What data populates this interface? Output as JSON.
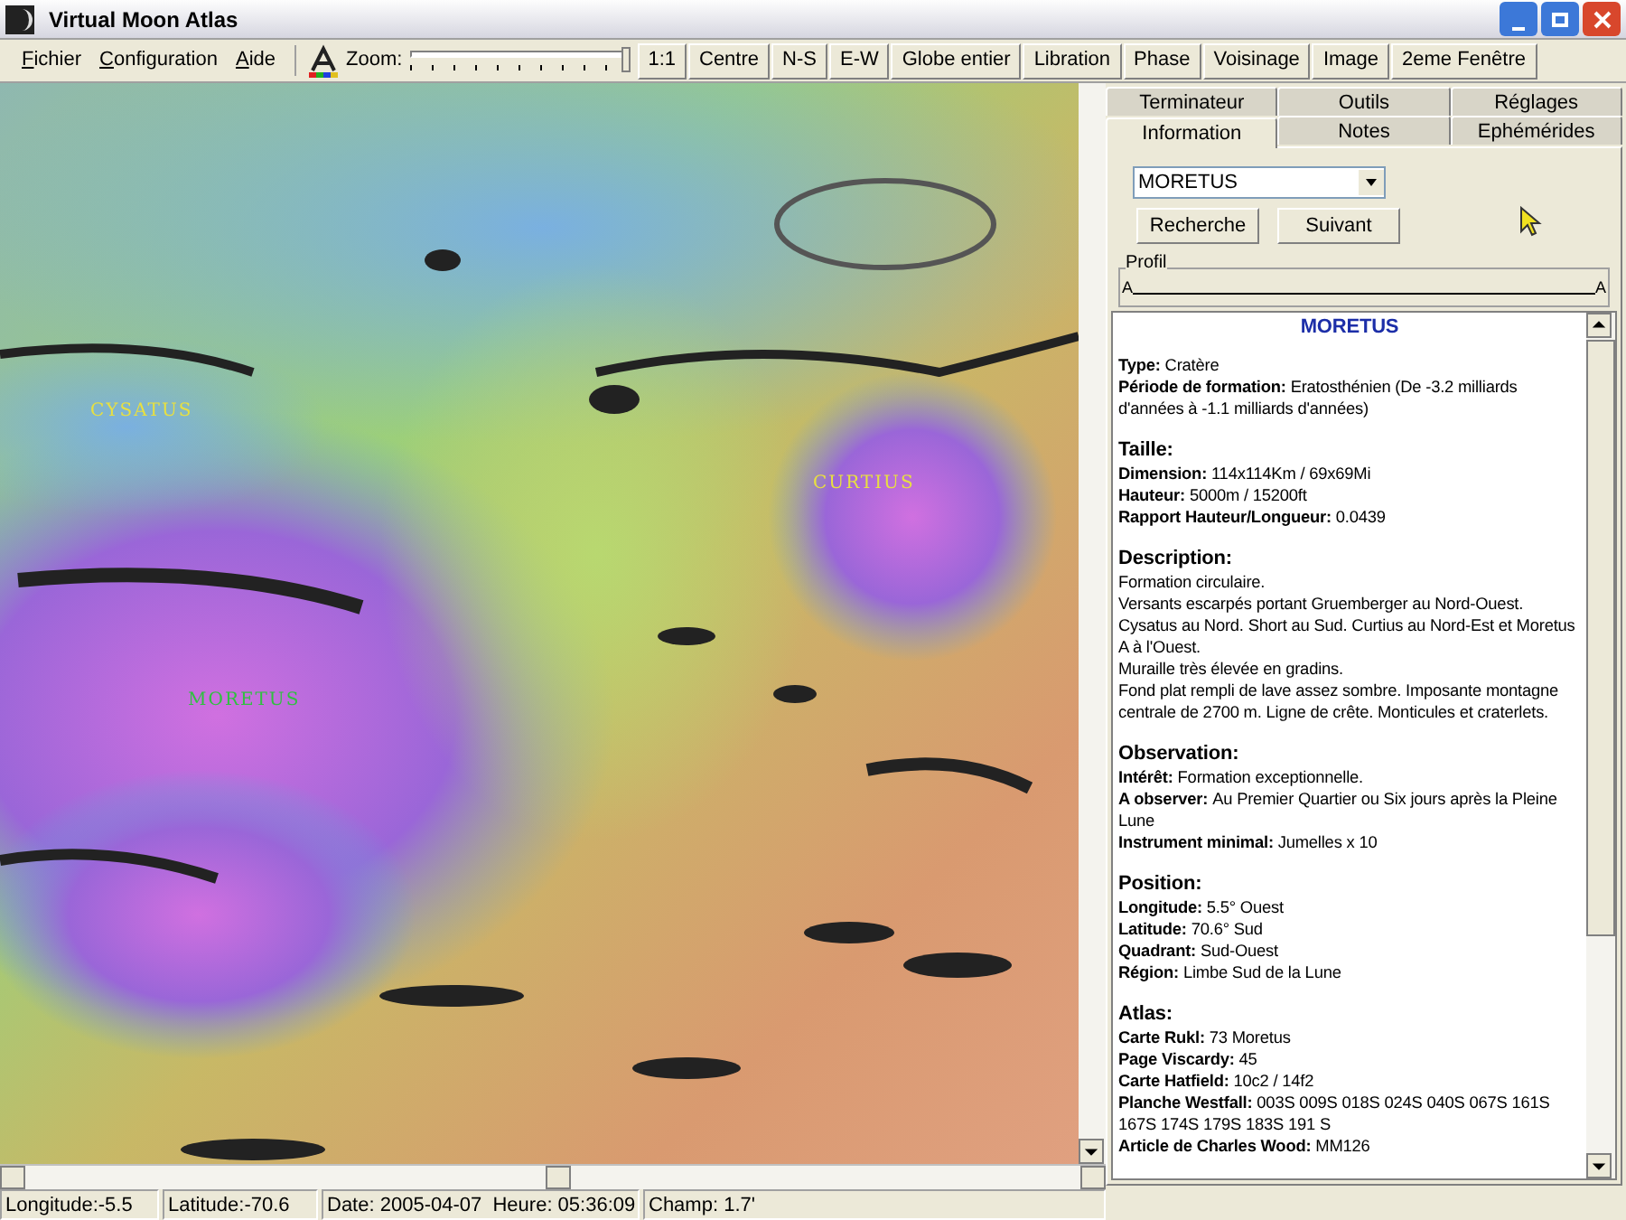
{
  "window": {
    "title": "Virtual Moon Atlas"
  },
  "menu": [
    "Fichier",
    "Configuration",
    "Aide"
  ],
  "toolbar": {
    "zoom_label": "Zoom:",
    "zoom": {
      "level": 1
    },
    "buttons": [
      "1:1",
      "Centre",
      "N-S",
      "E-W",
      "Globe entier",
      "Libration",
      "Phase",
      "Voisinage",
      "Image",
      "2eme Fenêtre"
    ]
  },
  "map": {
    "labels": [
      {
        "text": "CYSATUS",
        "color": "#e8e040"
      },
      {
        "text": "CURTIUS",
        "color": "#e8e040"
      },
      {
        "text": "MORETUS",
        "color": "#30c040"
      }
    ]
  },
  "tab_rows": [
    [
      {
        "label": "Terminateur",
        "selected": false
      },
      {
        "label": "Outils",
        "selected": false
      },
      {
        "label": "Réglages",
        "selected": false
      }
    ],
    [
      {
        "label": "Information",
        "selected": true
      },
      {
        "label": "Notes",
        "selected": false
      },
      {
        "label": "Ephémérides",
        "selected": false
      }
    ]
  ],
  "search": {
    "value": "MORETUS",
    "buttons": [
      "Recherche",
      "Suivant"
    ]
  },
  "profile": {
    "title": "Profil",
    "start_label": "A",
    "end_label": "A"
  },
  "info": {
    "title": "MORETUS",
    "sections": [
      {
        "lines": [
          {
            "label": "Type:",
            "value": "Cratère"
          },
          {
            "label": "Période de formation:",
            "value": "Eratosthénien (De -3.2 milliards d'années à -1.1 milliards d'années)"
          }
        ]
      },
      {
        "heading": "Taille:",
        "lines": [
          {
            "label": "Dimension:",
            "value": "114x114Km / 69x69Mi"
          },
          {
            "label": "Hauteur:",
            "value": "5000m / 15200ft"
          },
          {
            "label": "Rapport Hauteur/Longueur:",
            "value": "0.0439"
          }
        ]
      },
      {
        "heading": "Description:",
        "lines": [
          {
            "value": "Formation circulaire."
          },
          {
            "value": "Versants escarpés portant Gruemberger au Nord-Ouest. Cysatus au Nord. Short au Sud. Curtius au Nord-Est et Moretus A à l'Ouest."
          },
          {
            "value": "Muraille très élevée en gradins."
          },
          {
            "value": "Fond plat rempli de lave assez sombre. Imposante montagne centrale de 2700 m. Ligne de crête. Monticules et craterlets."
          }
        ]
      },
      {
        "heading": "Observation:",
        "lines": [
          {
            "label": "Intérêt:",
            "value": "Formation exceptionnelle."
          },
          {
            "label": "A observer:",
            "value": "Au Premier Quartier ou Six jours après la Pleine Lune"
          },
          {
            "label": "Instrument minimal:",
            "value": "Jumelles x 10"
          }
        ]
      },
      {
        "heading": "Position:",
        "lines": [
          {
            "label": "Longitude:",
            "value": "5.5° Ouest"
          },
          {
            "label": "Latitude:",
            "value": "70.6° Sud"
          },
          {
            "label": "Quadrant:",
            "value": "Sud-Ouest"
          },
          {
            "label": "Région:",
            "value": "Limbe Sud de la Lune"
          }
        ]
      },
      {
        "heading": "Atlas:",
        "lines": [
          {
            "label": "Carte Rukl:",
            "value": "73 Moretus"
          },
          {
            "label": "Page Viscardy:",
            "value": "45"
          },
          {
            "label": "Carte Hatfield:",
            "value": "10c2 / 14f2"
          },
          {
            "label": "Planche Westfall:",
            "value": "003S 009S 018S 024S 040S 067S 161S 167S 174S 179S 183S 191 S"
          },
          {
            "label": "Article de Charles Wood:",
            "value": "MM126"
          }
        ]
      }
    ]
  },
  "status_bar": [
    "Longitude:-5.5",
    "Latitude:-70.6",
    "Date: 2005-04-07  Heure: 05:36:09",
    "Champ: 1.7'"
  ]
}
